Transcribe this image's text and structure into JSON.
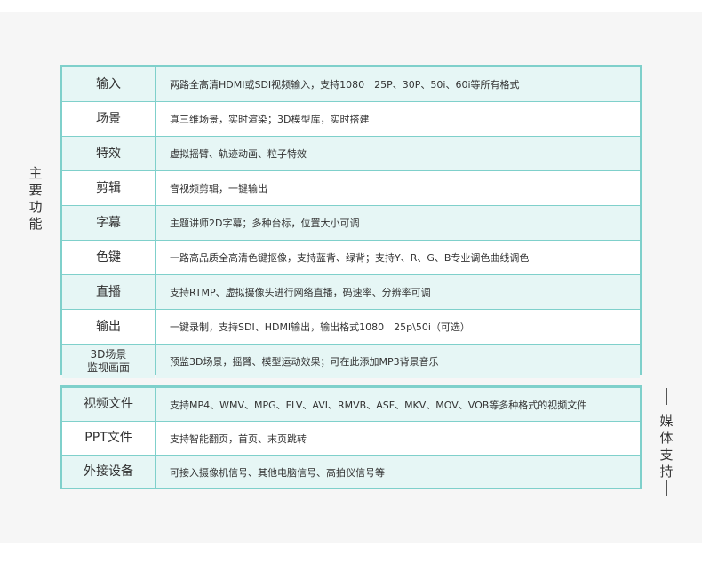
{
  "section_main": {
    "title": "主要功能",
    "rows": [
      {
        "label": "输入",
        "value": "两路全高清HDMI或SDI视频输入，支持1080　25P、30P、50i、60i等所有格式"
      },
      {
        "label": "场景",
        "value": "真三维场景，实时渲染；3D模型库，实时搭建"
      },
      {
        "label": "特效",
        "value": "虚拟摇臂、轨迹动画、粒子特效"
      },
      {
        "label": "剪辑",
        "value": "音视频剪辑，一键输出"
      },
      {
        "label": "字幕",
        "value": "主题讲师2D字幕；多种台标，位置大小可调"
      },
      {
        "label": "色键",
        "value": "一路高品质全高清色键抠像，支持蓝背、绿背；支持Y、R、G、B专业调色曲线调色"
      },
      {
        "label": "直播",
        "value": "支持RTMP、虚拟摄像头进行网络直播，码速率、分辨率可调"
      },
      {
        "label": "输出",
        "value": "一键录制，支持SDI、HDMI输出，输出格式1080　25p\\50i（可选）"
      },
      {
        "label": "3D场景\n监视画面",
        "label_line1": "3D场景",
        "label_line2": "监视画面",
        "value": "预监3D场景，摇臂、模型运动效果；可在此添加MP3背景音乐"
      }
    ]
  },
  "section_media": {
    "title": "媒体支持",
    "rows": [
      {
        "label": "视频文件",
        "value": "支持MP4、WMV、MPG、FLV、AVI、RMVB、ASF、MKV、MOV、VOB等多种格式的视频文件"
      },
      {
        "label": "PPT文件",
        "value": "支持智能翻页，首页、末页跳转"
      },
      {
        "label": "外接设备",
        "value": "可接入摄像机信号、其他电脑信号、高拍仪信号等"
      }
    ]
  },
  "colors": {
    "border": "#7fd0cb",
    "row_tint": "#e6f6f5",
    "background": "#f6f6f6"
  }
}
